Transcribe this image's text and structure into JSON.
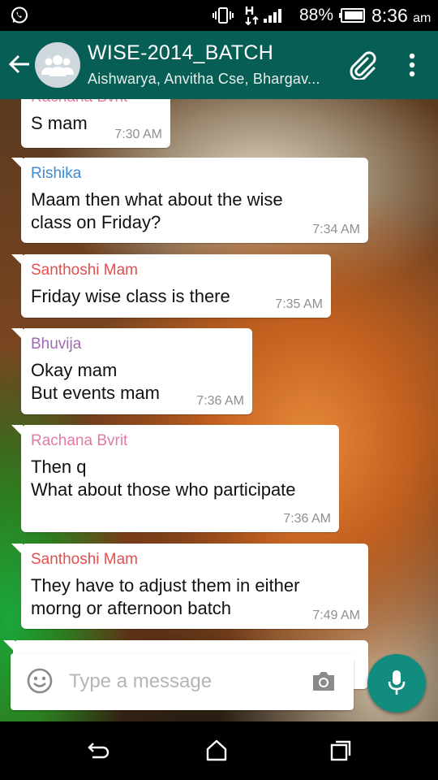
{
  "status_bar": {
    "battery_percent": "88%",
    "time": "8:36",
    "time_suffix": "am",
    "network_type": "H"
  },
  "header": {
    "title": "WISE-2014_BATCH",
    "subtitle": "Aishwarya, Anvitha Cse, Bhargav..."
  },
  "messages": [
    {
      "sender": "Rachana Bvrit",
      "sender_color": "#e27aa6",
      "lines": [
        "S mam"
      ],
      "time": "7:30 AM"
    },
    {
      "sender": "Rishika",
      "sender_color": "#3b8bd8",
      "lines": [
        "Maam then what about the wise",
        "class on Friday?"
      ],
      "time": "7:34 AM"
    },
    {
      "sender": "Santhoshi Mam",
      "sender_color": "#e0504e",
      "lines": [
        "Friday wise class is there"
      ],
      "time": "7:35 AM"
    },
    {
      "sender": "Bhuvija",
      "sender_color": "#a26ab0",
      "lines": [
        "Okay mam",
        "But events mam"
      ],
      "time": "7:36 AM"
    },
    {
      "sender": "Rachana Bvrit",
      "sender_color": "#e27aa6",
      "lines": [
        "Then q",
        "What about those who participate"
      ],
      "time": "7:36 AM"
    },
    {
      "sender": "Santhoshi Mam",
      "sender_color": "#e0504e",
      "lines": [
        "They have to adjust them in either",
        "morng or afternoon batch"
      ],
      "time": "7:49 AM"
    }
  ],
  "composer": {
    "placeholder": "Type a message"
  },
  "colors": {
    "header": "#075e54",
    "fab": "#128c7e"
  },
  "icons": [
    "whatsapp-icon",
    "vibrate-icon",
    "signal-icon",
    "battery-icon",
    "back-arrow-icon",
    "group-avatar-icon",
    "paperclip-icon",
    "more-vert-icon",
    "emoji-icon",
    "camera-icon",
    "mic-icon",
    "nav-back-icon",
    "nav-home-icon",
    "nav-recent-icon"
  ]
}
